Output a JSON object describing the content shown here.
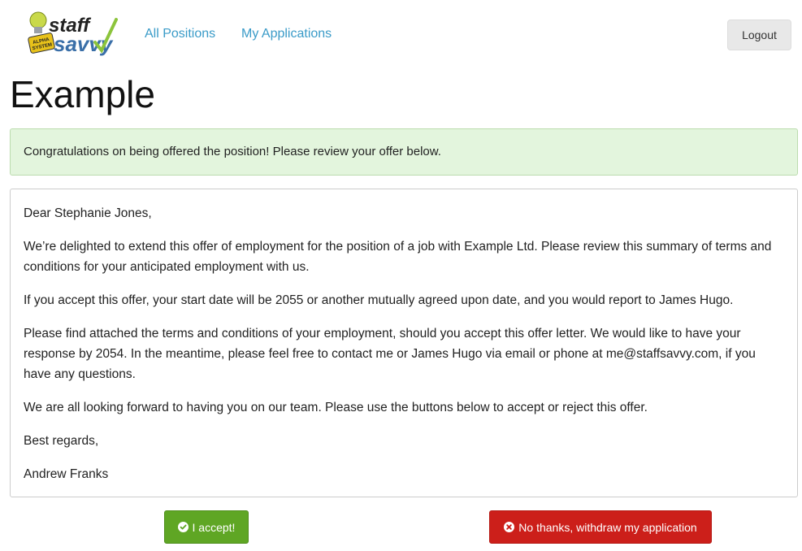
{
  "nav": {
    "logo_text_top": "staff",
    "logo_text_bottom": "savvy",
    "logo_badge": "ALPHA SYSTEM",
    "links": [
      "All Positions",
      "My Applications"
    ],
    "logout_label": "Logout"
  },
  "page": {
    "title": "Example"
  },
  "alert": {
    "message": "Congratulations on being offered the position! Please review your offer below."
  },
  "letter": {
    "greeting": "Dear Stephanie Jones,",
    "paragraphs": [
      "We’re delighted to extend this offer of employment for the position of a job with Example Ltd. Please review this summary of terms and conditions for your anticipated employment with us.",
      "If you accept this offer, your start date will be 2055 or another mutually agreed upon date, and you would report to James Hugo.",
      "Please find attached the terms and conditions of your employment, should you accept this offer letter. We would like to have your response by 2054. In the meantime, please feel free to contact me or James Hugo via email or phone at me@staffsavvy.com, if you have any questions.",
      "We are all looking forward to having you on our team. Please use the buttons below to accept or reject this offer."
    ],
    "closing": "Best regards,",
    "signature": "Andrew Franks"
  },
  "actions": {
    "accept_label": "I accept!",
    "accept_icon": "check-circle-icon",
    "reject_label": "No thanks, withdraw my application",
    "reject_icon": "times-circle-icon"
  },
  "colors": {
    "link": "#3a9bc8",
    "accept": "#5fa624",
    "reject": "#cc1f1a",
    "alert_bg": "#e3f5dd"
  }
}
